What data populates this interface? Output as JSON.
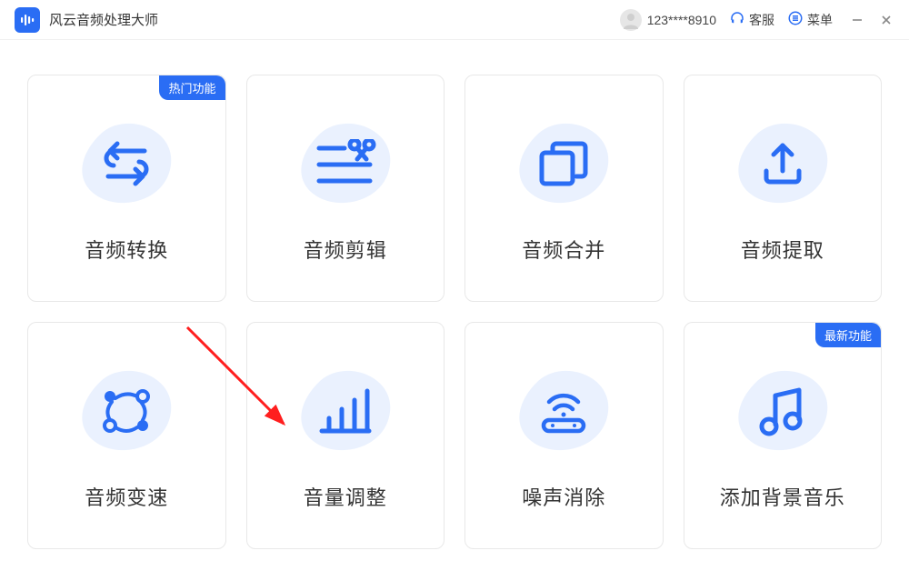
{
  "app": {
    "title": "风云音频处理大师"
  },
  "header": {
    "user_id": "123****8910",
    "support_label": "客服",
    "menu_label": "菜单"
  },
  "badges": {
    "hot": "热门功能",
    "new": "最新功能"
  },
  "cards": [
    {
      "label": "音频转换",
      "badge": "hot",
      "icon": "convert"
    },
    {
      "label": "音频剪辑",
      "badge": null,
      "icon": "cut"
    },
    {
      "label": "音频合并",
      "badge": null,
      "icon": "merge"
    },
    {
      "label": "音频提取",
      "badge": null,
      "icon": "extract"
    },
    {
      "label": "音频变速",
      "badge": null,
      "icon": "speed"
    },
    {
      "label": "音量调整",
      "badge": null,
      "icon": "volume"
    },
    {
      "label": "噪声消除",
      "badge": null,
      "icon": "noise"
    },
    {
      "label": "添加背景音乐",
      "badge": "new",
      "icon": "music"
    }
  ]
}
